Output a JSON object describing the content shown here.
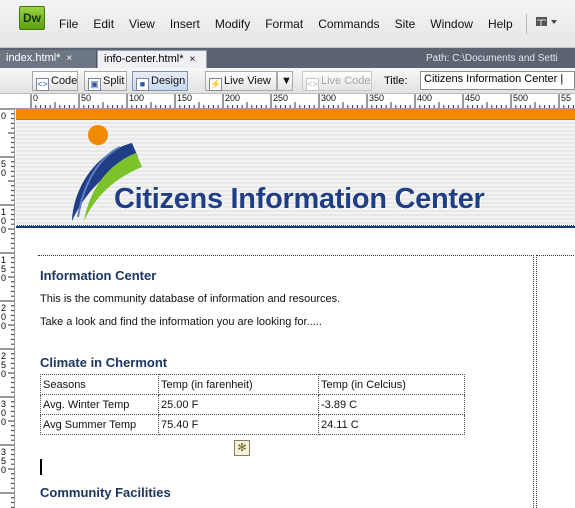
{
  "app": {
    "logo_text": "Dw",
    "menus": [
      "File",
      "Edit",
      "View",
      "Insert",
      "Modify",
      "Format",
      "Commands",
      "Site",
      "Window",
      "Help"
    ],
    "layout_button_icon": "layout-icon"
  },
  "tabs": [
    {
      "label": "index.html*",
      "close": "×"
    },
    {
      "label": "info-center.html*",
      "close": "×"
    }
  ],
  "path_text": "Path:  C:\\Documents and Setti",
  "toolbar": {
    "code_label": "Code",
    "split_label": "Split",
    "design_label": "Design",
    "live_view_label": "Live View",
    "live_code_label": "Live Code",
    "title_label": "Title:",
    "title_value": "Citizens Information Center |"
  },
  "ruler": {
    "top_numbers": [
      "0",
      "50",
      "100",
      "150",
      "200",
      "250",
      "300",
      "350",
      "400",
      "450",
      "500",
      "55"
    ],
    "left_numbers": [
      "0",
      "50",
      "100",
      "150",
      "200",
      "250",
      "300",
      "350"
    ]
  },
  "page": {
    "site_title": "Citizens Information Center",
    "section1": {
      "heading": "Information Center",
      "lines": [
        "This is the community database of information and resources.",
        "Take a look and find the information you are looking for....."
      ]
    },
    "section2": {
      "heading": "Climate in Chermont",
      "table": {
        "headers": [
          "Seasons",
          "Temp (in farenheit)",
          "Temp (in Celcius)"
        ],
        "rows": [
          [
            "Avg. Winter Temp",
            "25.00 F",
            "-3.89 C"
          ],
          [
            "Avg Summer Temp",
            "75.40 F",
            "24.11 C"
          ]
        ]
      }
    },
    "section3": {
      "heading": "Community Facilities"
    }
  },
  "colors": {
    "accent_orange": "#f28a00",
    "title_blue": "#1f3e86",
    "logo_green": "#7cc22a"
  }
}
